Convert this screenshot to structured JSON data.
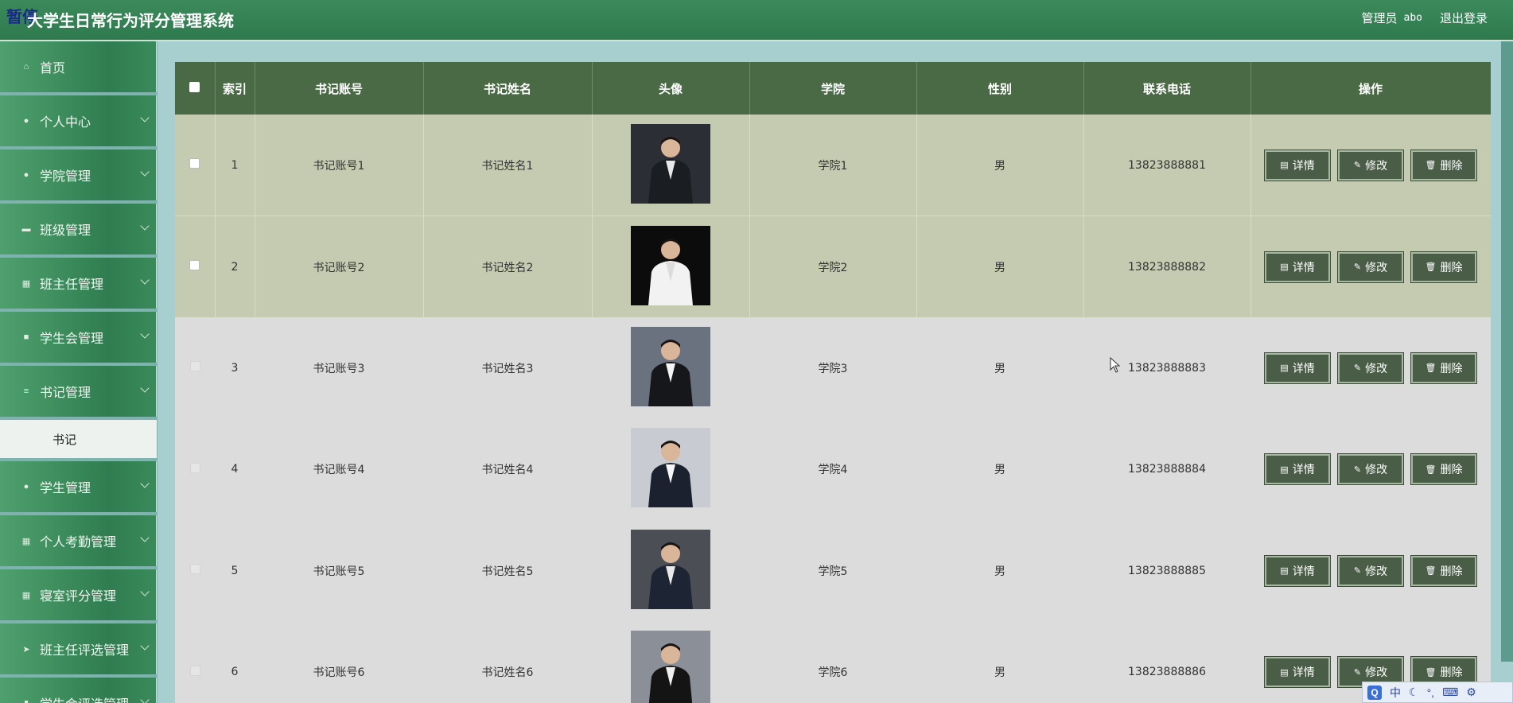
{
  "header": {
    "pause_badge": "暂停",
    "title": "大学生日常行为评分管理系统",
    "role": "管理员",
    "username": "abo",
    "logout": "退出登录"
  },
  "sidebar": {
    "items": [
      {
        "label": "首页",
        "icon": "home-icon"
      },
      {
        "label": "个人中心",
        "icon": "person-icon"
      },
      {
        "label": "学院管理",
        "icon": "person-icon"
      },
      {
        "label": "班级管理",
        "icon": "chat-icon"
      },
      {
        "label": "班主任管理",
        "icon": "grid-icon"
      },
      {
        "label": "学生会管理",
        "icon": "card-icon"
      },
      {
        "label": "书记管理",
        "icon": "list-icon"
      }
    ],
    "active_sub": "书记",
    "items_after": [
      {
        "label": "学生管理",
        "icon": "person-icon"
      },
      {
        "label": "个人考勤管理",
        "icon": "grid-icon"
      },
      {
        "label": "寝室评分管理",
        "icon": "grid-icon"
      },
      {
        "label": "班主任评选管理",
        "icon": "send-icon"
      },
      {
        "label": "学生会评选管理",
        "icon": "doc-icon"
      }
    ]
  },
  "table": {
    "headers": [
      "",
      "索引",
      "书记账号",
      "书记姓名",
      "头像",
      "学院",
      "性别",
      "联系电话",
      "操作"
    ],
    "rows": [
      {
        "index": "1",
        "account": "书记账号1",
        "name": "书记姓名1",
        "college": "学院1",
        "gender": "男",
        "phone": "13823888881"
      },
      {
        "index": "2",
        "account": "书记账号2",
        "name": "书记姓名2",
        "college": "学院2",
        "gender": "男",
        "phone": "13823888882"
      },
      {
        "index": "3",
        "account": "书记账号3",
        "name": "书记姓名3",
        "college": "学院3",
        "gender": "男",
        "phone": "13823888883"
      },
      {
        "index": "4",
        "account": "书记账号4",
        "name": "书记姓名4",
        "college": "学院4",
        "gender": "男",
        "phone": "13823888884"
      },
      {
        "index": "5",
        "account": "书记账号5",
        "name": "书记姓名5",
        "college": "学院5",
        "gender": "男",
        "phone": "13823888885"
      },
      {
        "index": "6",
        "account": "书记账号6",
        "name": "书记姓名6",
        "college": "学院6",
        "gender": "男",
        "phone": "13823888886"
      }
    ],
    "actions": {
      "detail": "详情",
      "edit": "修改",
      "delete": "删除"
    }
  },
  "ime": {
    "q": "Q",
    "lang": "中"
  },
  "colors": {
    "header": "#2e7a4e",
    "sidebar": "#3a8a5b",
    "table_head": "#4a6a45",
    "highlight_row": "#c4cbb0",
    "button": "#4a5e47"
  }
}
